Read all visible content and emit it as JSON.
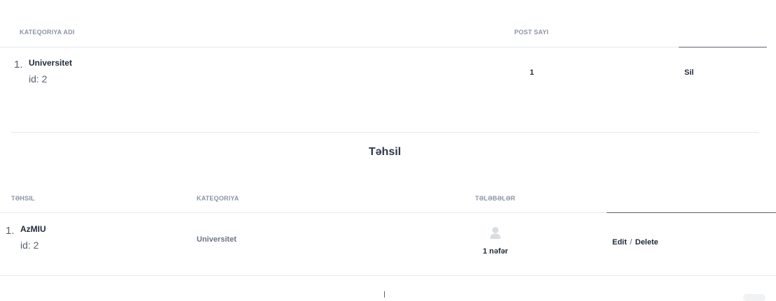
{
  "categories_table": {
    "headers": {
      "name": "KATEQORIYA ADI",
      "posts": "POST SAYI"
    },
    "rows": [
      {
        "index": "1.",
        "name": "Universitet",
        "id_text": "id: 2",
        "count": "1",
        "action": "Sil"
      }
    ]
  },
  "section": {
    "title": "Təhsil"
  },
  "education_table": {
    "headers": {
      "education": "TƏHSIL",
      "category": "KATEQORIYA",
      "students": "TƏLƏBƏLƏR"
    },
    "rows": [
      {
        "index": "1.",
        "name": "AzMIU",
        "id_text": "id: 2",
        "category": "Universitet",
        "students": "1 nəfər",
        "edit": "Edit",
        "separator": "/",
        "delete": "Delete"
      }
    ]
  },
  "icons": {
    "student_avatar": "user-avatar-icon"
  },
  "colors": {
    "header_text": "#8a94a6",
    "body_text": "#1e2a3a",
    "divider": "#e6e8ec",
    "avatar": "#d9dce1"
  }
}
